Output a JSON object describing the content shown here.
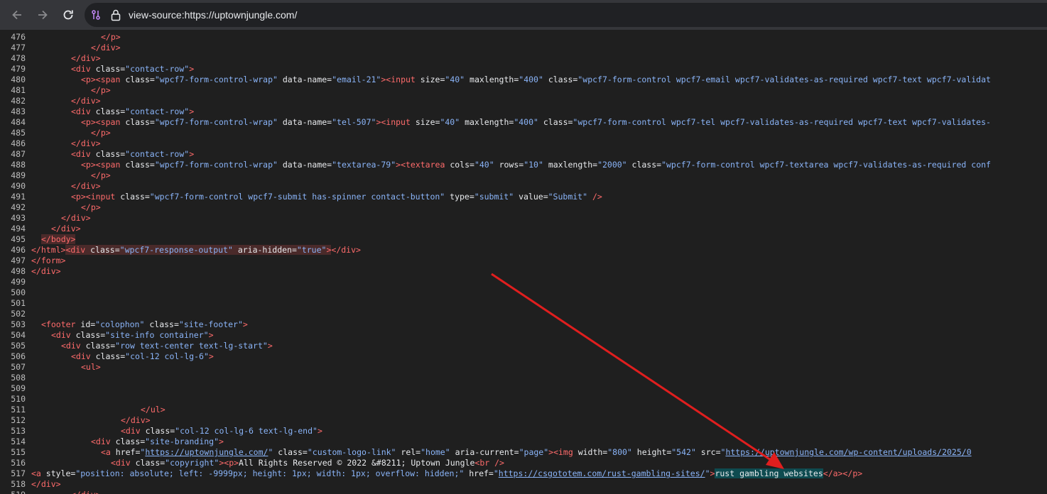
{
  "toolbar": {
    "address": "view-source:https://uptownjungle.com/",
    "back_icon": "back-arrow-icon",
    "forward_icon": "forward-arrow-icon",
    "reload_icon": "reload-icon",
    "site_info_icon": "tune-icon",
    "lock_icon": "lock-icon"
  },
  "lines": [
    {
      "n": "476",
      "i": 14,
      "s": [
        [
          "t",
          "</p>"
        ]
      ]
    },
    {
      "n": "477",
      "i": 12,
      "s": [
        [
          "t",
          "</div>"
        ]
      ]
    },
    {
      "n": "478",
      "i": 8,
      "s": [
        [
          "t",
          "</div>"
        ]
      ]
    },
    {
      "n": "479",
      "i": 8,
      "s": [
        [
          "t",
          "<div "
        ],
        [
          "a",
          "class="
        ],
        [
          "v",
          "\"contact-row\""
        ],
        [
          "t",
          ">"
        ]
      ]
    },
    {
      "n": "480",
      "i": 10,
      "s": [
        [
          "t",
          "<p><span "
        ],
        [
          "a",
          "class="
        ],
        [
          "v",
          "\"wpcf7-form-control-wrap\" "
        ],
        [
          "a",
          "data-name="
        ],
        [
          "v",
          "\"email-21\""
        ],
        [
          "t",
          "><input "
        ],
        [
          "a",
          "size="
        ],
        [
          "v",
          "\"40\" "
        ],
        [
          "a",
          "maxlength="
        ],
        [
          "v",
          "\"400\" "
        ],
        [
          "a",
          "class="
        ],
        [
          "v",
          "\"wpcf7-form-control wpcf7-email wpcf7-validates-as-required wpcf7-text wpcf7-validat"
        ]
      ]
    },
    {
      "n": "481",
      "i": 12,
      "s": [
        [
          "t",
          "</p>"
        ]
      ]
    },
    {
      "n": "482",
      "i": 8,
      "s": [
        [
          "t",
          "</div>"
        ]
      ]
    },
    {
      "n": "483",
      "i": 8,
      "s": [
        [
          "t",
          "<div "
        ],
        [
          "a",
          "class="
        ],
        [
          "v",
          "\"contact-row\""
        ],
        [
          "t",
          ">"
        ]
      ]
    },
    {
      "n": "484",
      "i": 10,
      "s": [
        [
          "t",
          "<p><span "
        ],
        [
          "a",
          "class="
        ],
        [
          "v",
          "\"wpcf7-form-control-wrap\" "
        ],
        [
          "a",
          "data-name="
        ],
        [
          "v",
          "\"tel-507\""
        ],
        [
          "t",
          "><input "
        ],
        [
          "a",
          "size="
        ],
        [
          "v",
          "\"40\" "
        ],
        [
          "a",
          "maxlength="
        ],
        [
          "v",
          "\"400\" "
        ],
        [
          "a",
          "class="
        ],
        [
          "v",
          "\"wpcf7-form-control wpcf7-tel wpcf7-validates-as-required wpcf7-text wpcf7-validates-"
        ]
      ]
    },
    {
      "n": "485",
      "i": 12,
      "s": [
        [
          "t",
          "</p>"
        ]
      ]
    },
    {
      "n": "486",
      "i": 8,
      "s": [
        [
          "t",
          "</div>"
        ]
      ]
    },
    {
      "n": "487",
      "i": 8,
      "s": [
        [
          "t",
          "<div "
        ],
        [
          "a",
          "class="
        ],
        [
          "v",
          "\"contact-row\""
        ],
        [
          "t",
          ">"
        ]
      ]
    },
    {
      "n": "488",
      "i": 10,
      "s": [
        [
          "t",
          "<p><span "
        ],
        [
          "a",
          "class="
        ],
        [
          "v",
          "\"wpcf7-form-control-wrap\" "
        ],
        [
          "a",
          "data-name="
        ],
        [
          "v",
          "\"textarea-79\""
        ],
        [
          "t",
          "><textarea "
        ],
        [
          "a",
          "cols="
        ],
        [
          "v",
          "\"40\" "
        ],
        [
          "a",
          "rows="
        ],
        [
          "v",
          "\"10\" "
        ],
        [
          "a",
          "maxlength="
        ],
        [
          "v",
          "\"2000\" "
        ],
        [
          "a",
          "class="
        ],
        [
          "v",
          "\"wpcf7-form-control wpcf7-textarea wpcf7-validates-as-required conf"
        ]
      ]
    },
    {
      "n": "489",
      "i": 12,
      "s": [
        [
          "t",
          "</p>"
        ]
      ]
    },
    {
      "n": "490",
      "i": 8,
      "s": [
        [
          "t",
          "</div>"
        ]
      ]
    },
    {
      "n": "491",
      "i": 8,
      "s": [
        [
          "t",
          "<p><input "
        ],
        [
          "a",
          "class="
        ],
        [
          "v",
          "\"wpcf7-form-control wpcf7-submit has-spinner contact-button\" "
        ],
        [
          "a",
          "type="
        ],
        [
          "v",
          "\"submit\" "
        ],
        [
          "a",
          "value="
        ],
        [
          "v",
          "\"Submit\" "
        ],
        [
          "t",
          "/>"
        ]
      ]
    },
    {
      "n": "492",
      "i": 10,
      "s": [
        [
          "t",
          "</p>"
        ]
      ]
    },
    {
      "n": "493",
      "i": 6,
      "s": [
        [
          "t",
          "</div>"
        ]
      ]
    },
    {
      "n": "494",
      "i": 4,
      "s": [
        [
          "t",
          "</div>"
        ]
      ]
    },
    {
      "n": "495",
      "i": 2,
      "s": [
        [
          "th",
          "</body>"
        ]
      ]
    },
    {
      "n": "496",
      "i": 0,
      "s": [
        [
          "t",
          "</html>"
        ],
        [
          "th",
          "<div "
        ],
        [
          "ah",
          "class="
        ],
        [
          "vh",
          "\"wpcf7-response-output\" "
        ],
        [
          "ah",
          "aria-hidden="
        ],
        [
          "vh",
          "\"true\""
        ],
        [
          "th",
          ">"
        ],
        [
          "t",
          "</div>"
        ]
      ]
    },
    {
      "n": "497",
      "i": 0,
      "s": [
        [
          "t",
          "</form>"
        ]
      ]
    },
    {
      "n": "498",
      "i": 0,
      "s": [
        [
          "t",
          "</div>"
        ]
      ]
    },
    {
      "n": "499",
      "i": 0,
      "s": []
    },
    {
      "n": "500",
      "i": 0,
      "s": []
    },
    {
      "n": "501",
      "i": 0,
      "s": []
    },
    {
      "n": "502",
      "i": 0,
      "s": []
    },
    {
      "n": "503",
      "i": 2,
      "s": [
        [
          "t",
          "<footer "
        ],
        [
          "a",
          "id="
        ],
        [
          "v",
          "\"colophon\" "
        ],
        [
          "a",
          "class="
        ],
        [
          "v",
          "\"site-footer\""
        ],
        [
          "t",
          ">"
        ]
      ]
    },
    {
      "n": "504",
      "i": 4,
      "s": [
        [
          "t",
          "<div "
        ],
        [
          "a",
          "class="
        ],
        [
          "v",
          "\"site-info container\""
        ],
        [
          "t",
          ">"
        ]
      ]
    },
    {
      "n": "505",
      "i": 6,
      "s": [
        [
          "t",
          "<div "
        ],
        [
          "a",
          "class="
        ],
        [
          "v",
          "\"row text-center text-lg-start\""
        ],
        [
          "t",
          ">"
        ]
      ]
    },
    {
      "n": "506",
      "i": 8,
      "s": [
        [
          "t",
          "<div "
        ],
        [
          "a",
          "class="
        ],
        [
          "v",
          "\"col-12 col-lg-6\""
        ],
        [
          "t",
          ">"
        ]
      ]
    },
    {
      "n": "507",
      "i": 10,
      "s": [
        [
          "t",
          "<ul>"
        ]
      ]
    },
    {
      "n": "508",
      "i": 0,
      "s": []
    },
    {
      "n": "509",
      "i": 0,
      "s": []
    },
    {
      "n": "510",
      "i": 0,
      "s": []
    },
    {
      "n": "511",
      "i": 22,
      "s": [
        [
          "t",
          "</ul>"
        ]
      ]
    },
    {
      "n": "512",
      "i": 18,
      "s": [
        [
          "t",
          "</div>"
        ]
      ]
    },
    {
      "n": "513",
      "i": 18,
      "s": [
        [
          "t",
          "<div "
        ],
        [
          "a",
          "class="
        ],
        [
          "v",
          "\"col-12 col-lg-6 text-lg-end\""
        ],
        [
          "t",
          ">"
        ]
      ]
    },
    {
      "n": "514",
      "i": 12,
      "s": [
        [
          "t",
          "<div "
        ],
        [
          "a",
          "class="
        ],
        [
          "v",
          "\"site-branding\""
        ],
        [
          "t",
          ">"
        ]
      ]
    },
    {
      "n": "515",
      "i": 14,
      "s": [
        [
          "t",
          "<a "
        ],
        [
          "a",
          "href="
        ],
        [
          "v",
          "\""
        ],
        [
          "l",
          "https://uptownjungle.com/"
        ],
        [
          "v",
          "\" "
        ],
        [
          "a",
          "class="
        ],
        [
          "v",
          "\"custom-logo-link\" "
        ],
        [
          "a",
          "rel="
        ],
        [
          "v",
          "\"home\" "
        ],
        [
          "a",
          "aria-current="
        ],
        [
          "v",
          "\"page\""
        ],
        [
          "t",
          "><img "
        ],
        [
          "a",
          "width="
        ],
        [
          "v",
          "\"800\" "
        ],
        [
          "a",
          "height="
        ],
        [
          "v",
          "\"542\" "
        ],
        [
          "a",
          "src="
        ],
        [
          "v",
          "\""
        ],
        [
          "l",
          "https://uptownjungle.com/wp-content/uploads/2025/0"
        ]
      ]
    },
    {
      "n": "516",
      "i": 16,
      "s": [
        [
          "t",
          "<div "
        ],
        [
          "a",
          "class="
        ],
        [
          "v",
          "\"copyright\""
        ],
        [
          "t",
          "><p>"
        ],
        [
          "x",
          "All Rights Reserved © 2022 &#8211; Uptown Jungle"
        ],
        [
          "t",
          "<br />"
        ]
      ]
    },
    {
      "n": "517",
      "i": 0,
      "s": [
        [
          "t",
          "<a "
        ],
        [
          "a",
          "style="
        ],
        [
          "v",
          "\"position: absolute; left: -9999px; height: 1px; width: 1px; overflow: hidden;\" "
        ],
        [
          "a",
          "href="
        ],
        [
          "v",
          "\""
        ],
        [
          "l",
          "https://csgototem.com/rust-gambling-sites/"
        ],
        [
          "v",
          "\""
        ],
        [
          "t",
          ">"
        ],
        [
          "xh",
          "rust gambling websites"
        ],
        [
          "t",
          "</a></p>"
        ]
      ]
    },
    {
      "n": "518",
      "i": 0,
      "s": [
        [
          "t",
          "</div>"
        ]
      ]
    },
    {
      "n": "519",
      "i": 8,
      "s": [
        [
          "t",
          "</div>"
        ]
      ]
    }
  ]
}
